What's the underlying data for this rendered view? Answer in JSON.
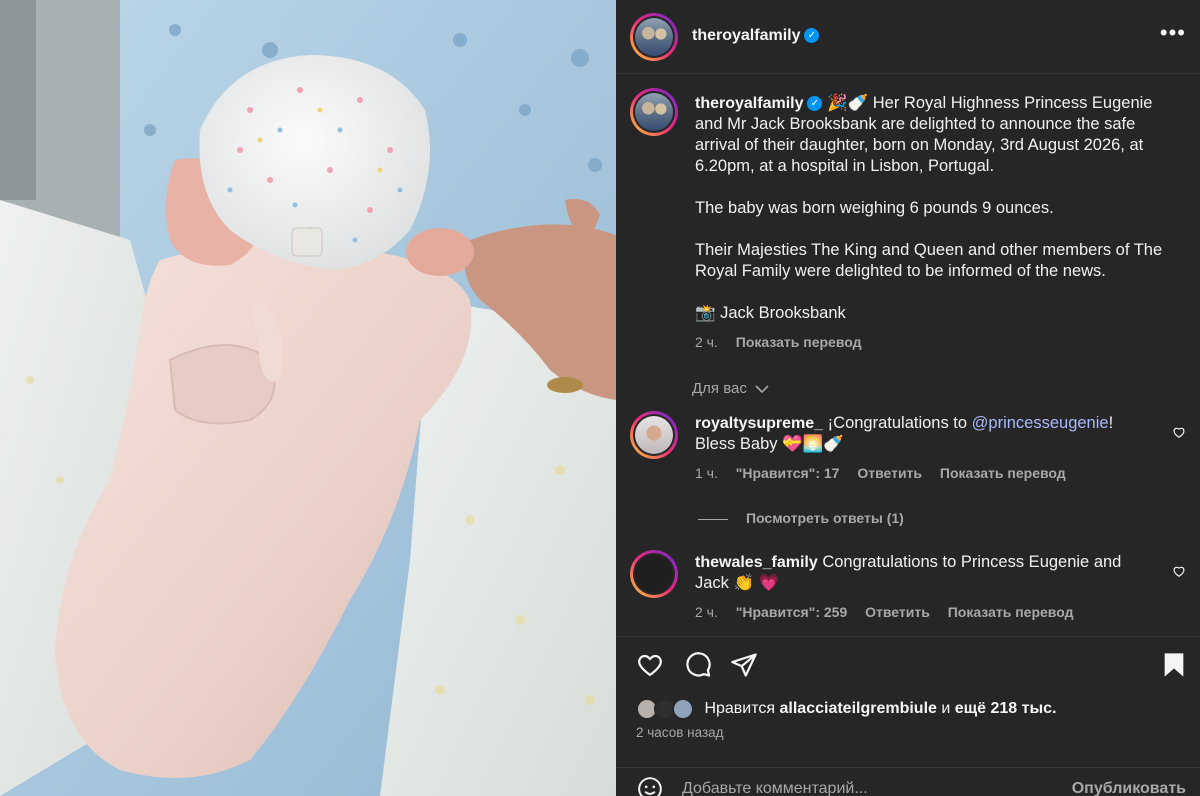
{
  "post": {
    "author": "theroyalfamily",
    "more_icon": "more-horizontal-icon"
  },
  "caption": {
    "username": "theroyalfamily",
    "emojis": "🎉🍼",
    "paragraph1": "Her Royal Highness Princess Eugenie and Mr Jack Brooksbank are delighted to announce the safe arrival of their daughter, born on Monday, 3rd August 2026, at 6.20pm, at a hospital in Lisbon, Portugal.",
    "paragraph2": "The baby was born weighing 6 pounds 9 ounces.",
    "paragraph3": "Their Majesties The King and Queen and other members of The Royal Family were delighted to be informed of the news.",
    "credit": "📸 Jack Brooksbank",
    "time": "2 ч.",
    "translate": "Показать перевод"
  },
  "for_you": "Для вас",
  "comments": [
    {
      "username": "royaltysupreme_",
      "text_before": "¡Congratulations to ",
      "mention": "@princesseugenie",
      "text_after": "! Bless Baby 💝🌅🍼",
      "time": "1 ч.",
      "likes": "\"Нравится\": 17",
      "reply": "Ответить",
      "translate": "Показать перевод"
    },
    {
      "username": "thewales_family",
      "text_before": "Congratulations to Princess Eugenie and Jack 👏 💗",
      "time": "2 ч.",
      "likes": "\"Нравится\": 259",
      "reply": "Ответить",
      "translate": "Показать перевод"
    }
  ],
  "view_replies": "Посмотреть ответы (1)",
  "likes_line": {
    "prefix": "Нравится",
    "user": "allacciateilgrembiule",
    "middle": "и",
    "rest": "ещё 218 тыс."
  },
  "posted_ago": "2 часов назад",
  "add_comment": {
    "placeholder": "Добавьте комментарий...",
    "publish": "Опубликовать"
  },
  "colors": {
    "panel_bg": "#262626",
    "verified": "#0095f6",
    "mention": "#a9b9ff",
    "muted": "#a8a8a8"
  }
}
